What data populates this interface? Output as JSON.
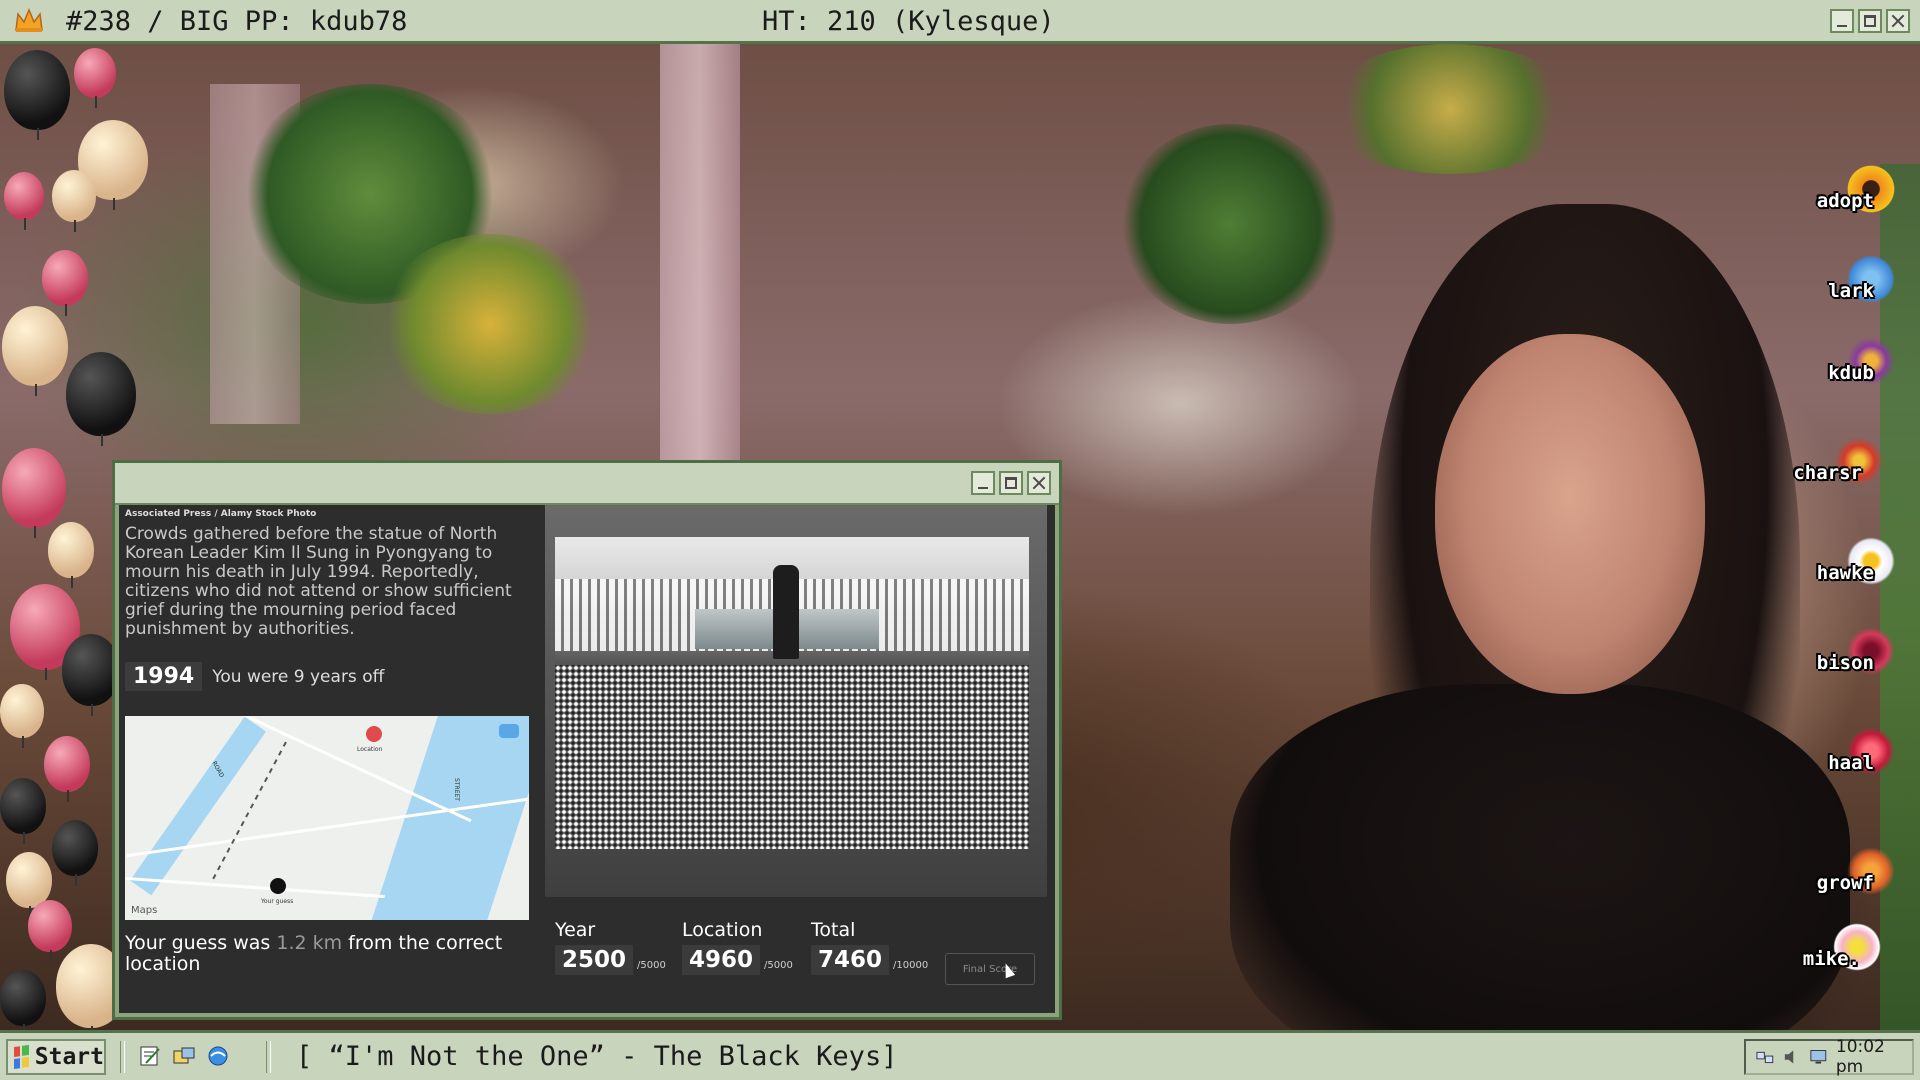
{
  "top_bar": {
    "left_title": "#238 / BIG PP: kdub78",
    "center_title": "HT: 210 (Kylesque)",
    "crown_icon": "crown-icon"
  },
  "viewers": [
    "adopt",
    "lark",
    "kdub",
    "charsr",
    "hawke",
    "bison",
    "haal",
    "growf",
    "mike."
  ],
  "game": {
    "photo_credit": "Associated Press / Alamy Stock Photo",
    "caption": "Crowds gathered before the statue of North Korean Leader Kim Il Sung in Pyongyang to mourn his death in July 1994. Reportedly, citizens who did not attend or show sufficient grief during the mourning period faced punishment by authorities.",
    "answer_year": "1994",
    "years_off_text": "You were 9 years off",
    "map": {
      "correct_label": "Location",
      "guess_label": "Your guess",
      "attribution": "Maps",
      "street_labels": [
        "STREET",
        "ROAD"
      ]
    },
    "guess_prefix": "Your guess was ",
    "guess_distance": "1.2 km",
    "guess_suffix": " from the correct location",
    "scores": [
      {
        "label": "Year",
        "value": "2500",
        "max": "/5000"
      },
      {
        "label": "Location",
        "value": "4960",
        "max": "/5000"
      },
      {
        "label": "Total",
        "value": "7460",
        "max": "/10000"
      }
    ],
    "final_score_button": "Final Score"
  },
  "taskbar": {
    "start_label": "Start",
    "now_playing": "[ “I'm Not the One” - The Black Keys]",
    "clock": "10:02 pm",
    "quick_launch": [
      "notepad-icon",
      "explorer-icon",
      "browser-icon"
    ]
  }
}
